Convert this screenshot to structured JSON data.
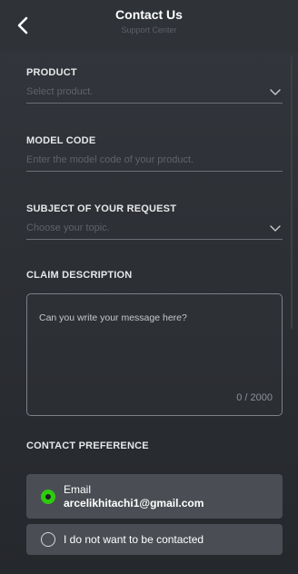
{
  "header": {
    "title": "Contact Us",
    "subtitle": "Support Center",
    "back_icon": "chevron-left-icon"
  },
  "product": {
    "label": "PRODUCT",
    "placeholder": "Select product.",
    "icon": "chevron-down-icon"
  },
  "model_code": {
    "label": "MODEL CODE",
    "placeholder": "Enter the model code of your product."
  },
  "subject": {
    "label": "SUBJECT OF YOUR REQUEST",
    "placeholder": "Choose your topic.",
    "icon": "chevron-down-icon"
  },
  "claim": {
    "label": "CLAIM DESCRIPTION",
    "placeholder": "Can you write your message here?",
    "counter": "0 / 2000"
  },
  "contact_preference": {
    "label": "CONTACT PREFERENCE",
    "options": [
      {
        "title": "Email",
        "detail": "arcelikhitachi1@gmail.com",
        "selected": true
      },
      {
        "title": "I do not want to be contacted",
        "selected": false
      }
    ]
  },
  "colors": {
    "accent": "#2ecc0f",
    "background": "#2d3035",
    "option_bg": "#4a4e54"
  }
}
